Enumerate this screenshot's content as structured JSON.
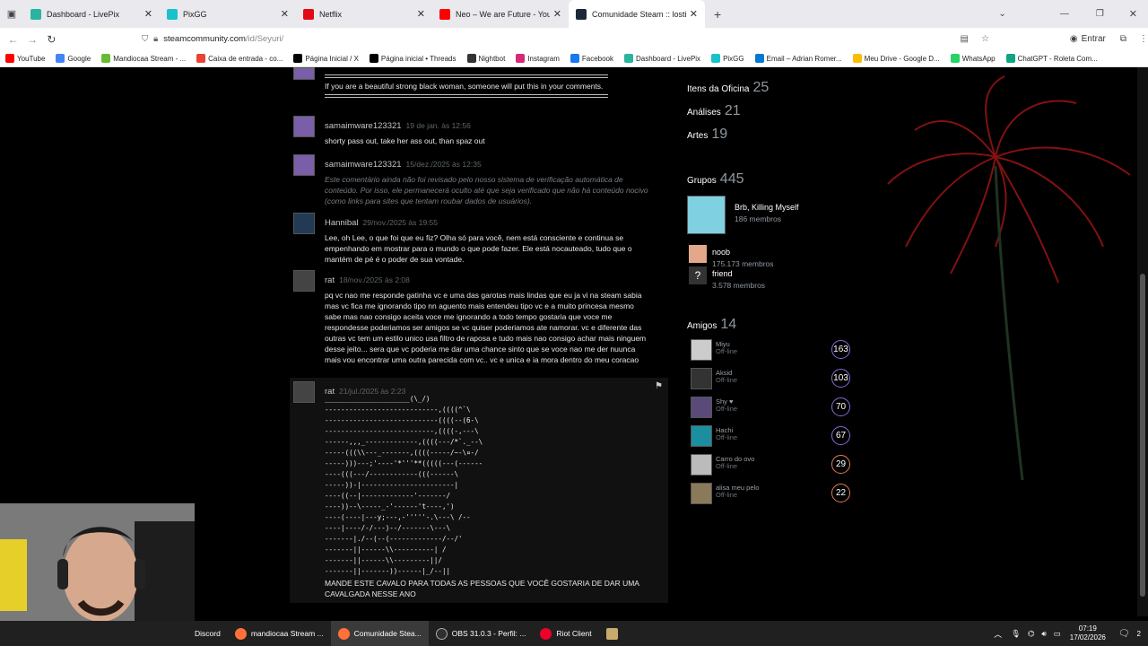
{
  "tabs": [
    {
      "label": "Dashboard - LivePix",
      "color": "#2bb3a0"
    },
    {
      "label": "PixGG",
      "color": "#19c2c9"
    },
    {
      "label": "Netflix",
      "color": "#e50914"
    },
    {
      "label": "Neo – We are Future - YouT",
      "color": "#ff0000"
    },
    {
      "label": "Comunidade Steam :: lostinsuffi",
      "color": "#1b2838"
    }
  ],
  "url": {
    "host": "steamcommunity.com",
    "path": "/id/Seyuri/"
  },
  "nav": {
    "signin": "Entrar"
  },
  "bookmarks": [
    "YouTube",
    "Google",
    "Mandiocaa Stream - ...",
    "Caixa de entrada - co...",
    "Página Inicial / X",
    "Página inicial • Threads",
    "Nightbot",
    "Instagram",
    "Facebook",
    "Dashboard - LivePix",
    "PixGG",
    "Email – Adrian Romer...",
    "Meu Drive - Google D...",
    "WhatsApp",
    "ChatGPT - Roleta Com..."
  ],
  "comments": [
    {
      "author": "",
      "date": "",
      "body": "If you are a beautiful strong black woman, someone will put this in your comments.",
      "top": "-8"
    },
    {
      "author": "samaimware123321",
      "date": "19 de jan. às 12:56",
      "body": "shorty pass out, take her ass out, than spaz out"
    },
    {
      "author": "samaimware123321",
      "date": "15/dez./2025 às 12:35",
      "body": "Este comentário ainda não foi revisado pelo nosso sistema de verificação automática de conteúdo. Por isso, ele permanecerá oculto até que seja verificado que não há conteúdo nocivo (como links para sites que tentam roubar dados de usuários)."
    },
    {
      "author": "Hannibal",
      "date": "29/nov./2025 às 19:55",
      "body": "Lee, oh Lee, o que foi que eu fiz? Olha só para você, nem está consciente e continua se empenhando em mostrar para o mundo o que pode fazer. Ele está nocauteado, tudo que o mantém de pé é o poder de sua vontade."
    },
    {
      "author": "rat",
      "date": "18/nov./2025 às 2:08",
      "body": "pq vc nao me responde gatinha vc e uma das garotas mais lindas que eu ja vi na steam sabia mas vc fica me ignorando tipo nn aguento mais entendeu tipo vc e a muito princesa mesmo sabe mas nao consigo aceita voce me ignorando a todo tempo gostaria que voce me respondesse poderiamos ser amigos se vc quiser poderiamos ate namorar. vc e diferente das outras vc tem um estilo unico usa filtro de raposa e tudo mais nao consigo achar mais ninguem desse jeito... sera que vc poderia me dar uma chance sinto que se voce nao me der nuunca mais vou encontrar uma outra parecida com vc.. vc e unica e ia mora dentro do meu coracao"
    },
    {
      "author": "rat",
      "date": "21/jul./2025 às 2:23",
      "body": "MANDE ESTE CAVALO PARA TODAS AS PESSOAS QUE VOCÊ GOSTARIA DE DAR UMA CAVALGADA NESSE ANO"
    }
  ],
  "ascii": "_____________________(\\_/)\n----------------------------,((((^`\\\n----------------------------((((--(6-\\\n---------------------------,((((-,---\\\n------,,,_-------------,((((---/*`._--\\\n-----(((\\\\---_-------,((((-----/~-\\¤-/\n-----)))---;'----'*'''**(((((---(------\n----(((---/------------(((------\\\n-----))-|-----------------------|\n----((--|-------------'-------/\n----))--\\-----_-'------'t----,')\n----(----|---y;---,-'''''-.\\---\\ /--\n----|----/-/---)--/-------\\---\\\n-------|./--(--(-------------/--/'\n-------||------\\\\----------| /\n-------||------\\\\---------||/\n-------||-------))------|_/--||",
  "sidebar": {
    "stats": [
      {
        "label": "Itens da Oficina",
        "value": "25"
      },
      {
        "label": "Análises",
        "value": "21"
      },
      {
        "label": "Artes",
        "value": "19"
      }
    ],
    "groups_label": "Grupos",
    "groups_count": "445",
    "groups": [
      {
        "name": "Brb, Killing Myself",
        "members": "186 membros"
      },
      {
        "name": "noob",
        "members": "175.173 membros"
      },
      {
        "name": "friend",
        "members": "3.578 membros"
      }
    ],
    "friends_label": "Amigos",
    "friends_count": "14",
    "friends": [
      {
        "name": "Miyu",
        "status": "Off-line",
        "level": "163",
        "color": "#8b6bd6"
      },
      {
        "name": "Aksid",
        "status": "Off-line",
        "level": "103",
        "color": "#8b6bd6"
      },
      {
        "name": "Shy ♥",
        "status": "Off-line",
        "level": "70",
        "color": "#8b6bd6"
      },
      {
        "name": "Hachi",
        "status": "Off-line",
        "level": "67",
        "color": "#8b6bd6"
      },
      {
        "name": "Carro do ovo",
        "status": "Off-line",
        "level": "29",
        "color": "#e07a5a"
      },
      {
        "name": "alisa meu pelo",
        "status": "Off-line",
        "level": "22",
        "color": "#e07a5a"
      }
    ]
  },
  "taskbar": [
    {
      "label": "Discord",
      "color": "#5865f2"
    },
    {
      "label": "mandiocaa Stream ...",
      "color": "#ff7139"
    },
    {
      "label": "Comunidade Stea...",
      "color": "#ff7139"
    },
    {
      "label": "OBS 31.0.3 - Perfil: ...",
      "color": "#302e31"
    },
    {
      "label": "Riot Client",
      "color": "#eb0029"
    }
  ],
  "clock": {
    "time": "07:19",
    "date": "17/02/2026"
  },
  "notifications": "2"
}
